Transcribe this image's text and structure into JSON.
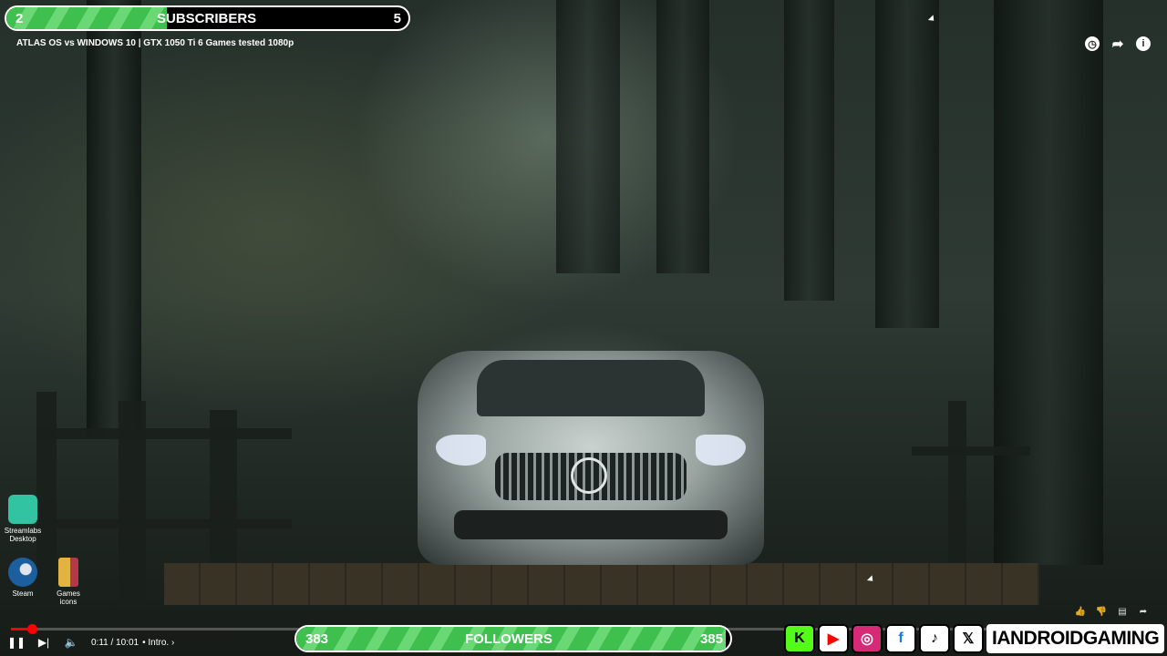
{
  "subscribers": {
    "current": "2",
    "label": "SUBSCRIBERS",
    "goal": "5",
    "progress": 0.4
  },
  "video": {
    "title": "ATLAS OS vs WINDOWS 10 | GTX 1050 Ti 6 Games tested 1080p"
  },
  "top_icons": [
    "watch-later-icon",
    "share-icon",
    "info-icon"
  ],
  "desktop_icons": [
    {
      "label": "Streamlabs Desktop",
      "icon": "streamlabs-icon",
      "color": "#31c3a2"
    },
    {
      "label": "Steam",
      "icon": "steam-icon",
      "color": "#1b5f9e"
    },
    {
      "label": "Games icons",
      "icon": "folder-icon",
      "color": "#e3b341"
    }
  ],
  "player": {
    "time": "0:11 / 10:01",
    "chapter": "• Intro. ›",
    "played_fraction": 0.0183
  },
  "followers": {
    "current": "383",
    "label": "FOLLOWERS",
    "goal": "385",
    "progress": 0.99
  },
  "socials": [
    {
      "name": "kick",
      "glyph": "K",
      "color": "#53fc18"
    },
    {
      "name": "youtube",
      "glyph": "▶",
      "color": "#ff0000"
    },
    {
      "name": "instagram",
      "glyph": "◎",
      "color": "#d62976"
    },
    {
      "name": "facebook",
      "glyph": "f",
      "color": "#1877f2"
    },
    {
      "name": "tiktok",
      "glyph": "♪",
      "color": "#000000"
    },
    {
      "name": "x",
      "glyph": "𝕏",
      "color": "#000000"
    }
  ],
  "brand": "IANDROIDGAMING"
}
